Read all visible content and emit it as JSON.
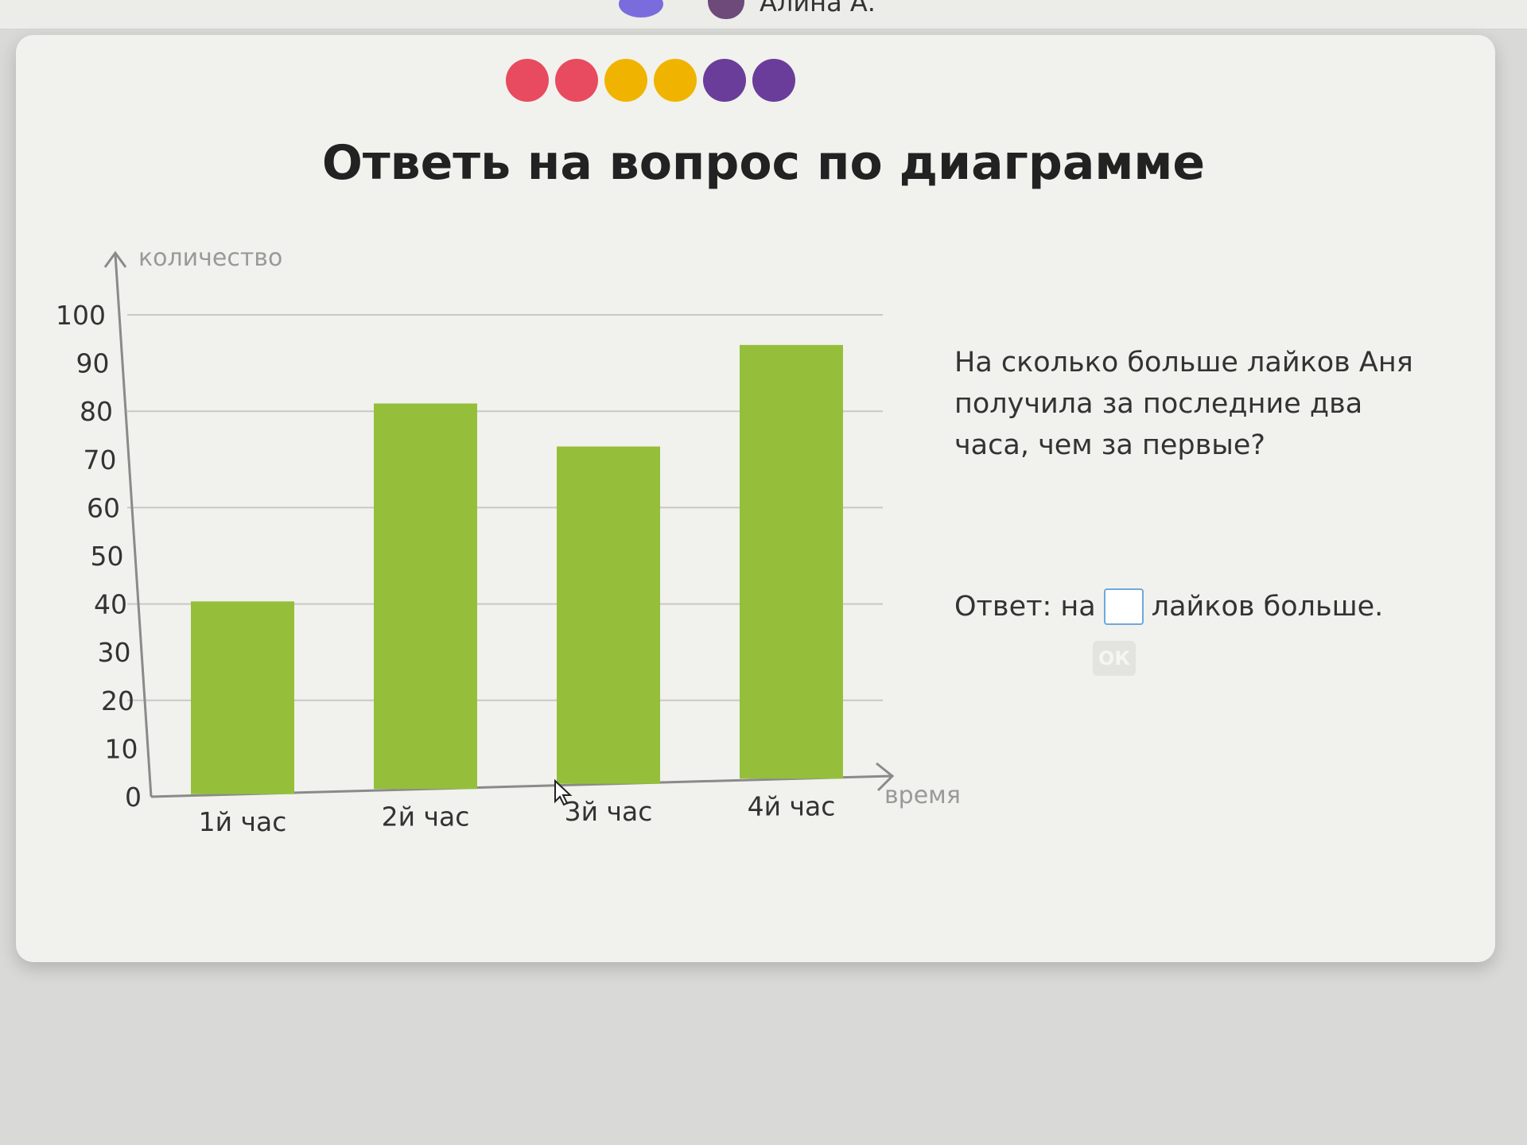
{
  "header": {
    "user_name": "Алина А."
  },
  "progress_dots": [
    "#e84a5f",
    "#e84a5f",
    "#f0b400",
    "#f0b400",
    "#6a3d9a",
    "#6a3d9a"
  ],
  "title": "Ответь на вопрос по диаграмме",
  "chart_data": {
    "type": "bar",
    "categories": [
      "1й час",
      "2й час",
      "3й час",
      "4й час"
    ],
    "values": [
      40,
      80,
      70,
      90
    ],
    "ylabel": "количество",
    "xlabel": "время",
    "ylim": [
      0,
      100
    ],
    "yticks": [
      0,
      10,
      20,
      30,
      40,
      50,
      60,
      70,
      80,
      90,
      100
    ],
    "gridlines": [
      20,
      40,
      60,
      80,
      100
    ],
    "bar_color": "#95bf3b"
  },
  "question": {
    "text": "На сколько больше лайков Аня получила за последние два часа, чем за первые?",
    "answer_prefix": "Ответ: на",
    "answer_suffix": "лайков больше.",
    "answer_value": "",
    "ok_label": "ОК"
  }
}
